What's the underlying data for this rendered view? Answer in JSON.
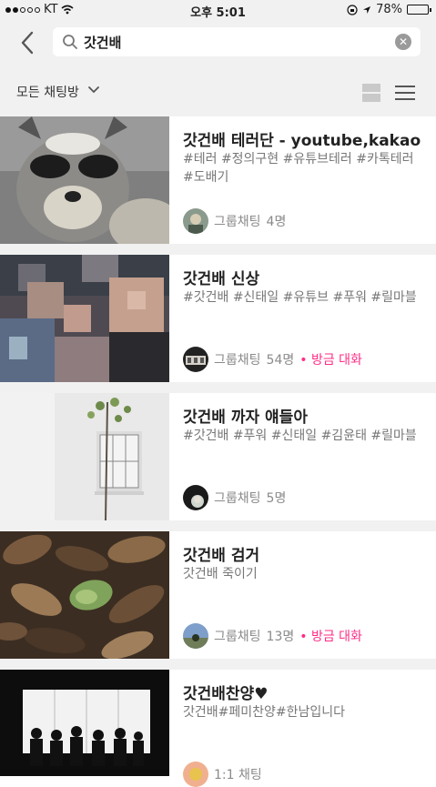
{
  "status_bar": {
    "carrier": "KT",
    "time": "오후 5:01",
    "battery": "78%",
    "battery_level": 0.78
  },
  "search": {
    "query": "갓건배",
    "back_icon": "back-chevron-icon",
    "search_icon": "magnifier-icon",
    "clear_icon": "clear-x-icon"
  },
  "filter": {
    "label": "모든 채팅방",
    "dropdown_icon": "chevron-down-icon",
    "view_toggle_icon": "card-view-icon",
    "menu_icon": "hamburger-menu-icon"
  },
  "rooms": [
    {
      "title": "갓건배 테러단 - youtube,kakao",
      "description": "#테러 #정의구현 #유튜브테러 #카톡테러 #도배기",
      "type": "그룹채팅",
      "members": "4명",
      "recent": "",
      "thumbnail": "raccoon-photo",
      "thumb_color": "#6a6a6a"
    },
    {
      "title": "갓건배 신상",
      "description": "#갓건배 #신태일 #유튜브 #푸워 #릴마블",
      "type": "그룹채팅",
      "members": "54명",
      "recent": "방금 대화",
      "thumbnail": "pixelated-people-photo",
      "thumb_color": "#5b5560"
    },
    {
      "title": "갓건배 까자 얘들아",
      "description": "#갓건배 #푸워 #신태일 #김윤태 #릴마블",
      "type": "그룹채팅",
      "members": "5명",
      "recent": "",
      "thumbnail": "white-wall-tree-photo",
      "thumb_color": "#e6e6e6"
    },
    {
      "title": "갓건배 검거",
      "description": "갓건배 죽이기",
      "type": "그룹채팅",
      "members": "13명",
      "recent": "방금 대화",
      "thumbnail": "autumn-leaves-photo",
      "thumb_color": "#4a3a2c"
    },
    {
      "title": "갓건배찬양♥",
      "description": "갓건배#페미찬양#한남입니다",
      "type": "1:1 채팅",
      "members": "",
      "recent": "",
      "thumbnail": "silhouette-window-photo",
      "thumb_color": "#111111"
    }
  ]
}
